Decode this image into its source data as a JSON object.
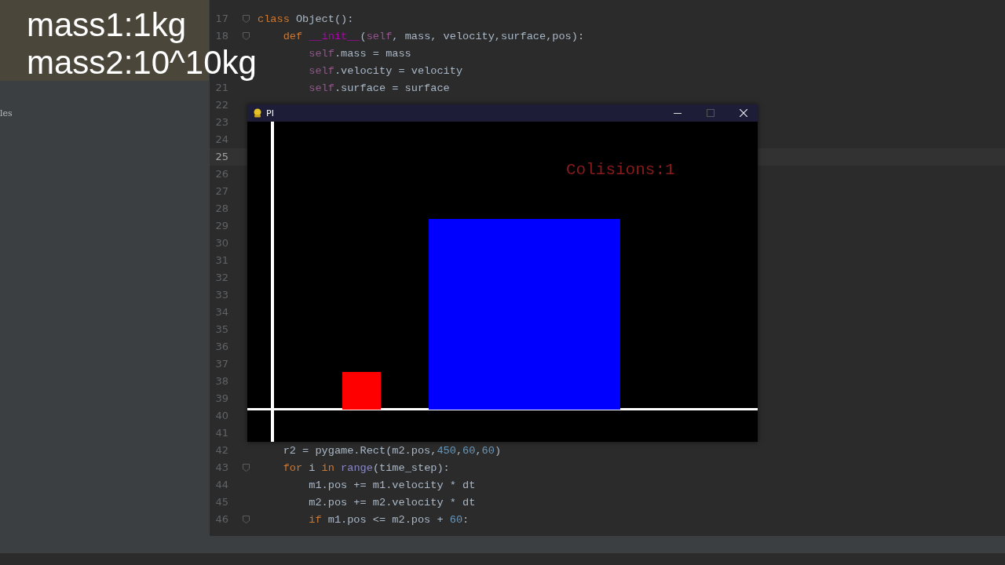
{
  "overlay_caption": [
    "mass1:1kg",
    "mass2:10^10kg"
  ],
  "sidebar": {
    "label": "les"
  },
  "editor": {
    "lines": [
      {
        "number": "17",
        "current": false,
        "fold": true,
        "kind": "flush",
        "tokens": [
          {
            "kind": "keyword",
            "text": "class"
          },
          {
            "kind": "plain",
            "text": " Object():"
          }
        ]
      },
      {
        "number": "18",
        "current": false,
        "fold": true,
        "kind": "indented",
        "tokens": [
          {
            "kind": "keyword",
            "text": "def "
          },
          {
            "kind": "magic",
            "text": "__init__"
          },
          {
            "kind": "plain",
            "text": "("
          },
          {
            "kind": "self",
            "text": "self"
          },
          {
            "kind": "plain",
            "text": ", mass, velocity,surface,pos):"
          }
        ]
      },
      {
        "current": false,
        "fold": false,
        "kind": "nested",
        "tokens": [
          {
            "kind": "self",
            "text": "self"
          },
          {
            "kind": "plain",
            "text": ".mass = mass"
          }
        ]
      },
      {
        "current": false,
        "fold": false,
        "kind": "nested",
        "tokens": [
          {
            "kind": "self",
            "text": "self"
          },
          {
            "kind": "plain",
            "text": ".velocity = velocity"
          }
        ]
      },
      {
        "number": "21",
        "current": false,
        "fold": false,
        "kind": "nested",
        "tokens": [
          {
            "kind": "self",
            "text": "self"
          },
          {
            "kind": "plain",
            "text": ".surface = surface"
          }
        ]
      },
      {
        "number": "22",
        "current": false,
        "fold": false
      },
      {
        "number": "23",
        "current": false,
        "fold": false
      },
      {
        "number": "24",
        "current": false,
        "fold": false
      },
      {
        "number": "25",
        "current": true,
        "fold": false
      },
      {
        "number": "26",
        "current": false,
        "fold": false
      },
      {
        "number": "27",
        "current": false,
        "fold": false
      },
      {
        "number": "28",
        "current": false,
        "fold": false
      },
      {
        "number": "29",
        "current": false,
        "fold": false
      },
      {
        "number": "30",
        "current": false,
        "fold": false
      },
      {
        "number": "31",
        "current": false,
        "fold": false
      },
      {
        "number": "32",
        "current": false,
        "fold": false
      },
      {
        "number": "33",
        "current": false,
        "fold": false
      },
      {
        "number": "34",
        "current": false,
        "fold": false
      },
      {
        "number": "35",
        "current": false,
        "fold": false
      },
      {
        "number": "36",
        "current": false,
        "fold": false
      },
      {
        "number": "37",
        "current": false,
        "fold": false
      },
      {
        "number": "38",
        "current": false,
        "fold": false
      },
      {
        "number": "39",
        "current": false,
        "fold": false
      },
      {
        "number": "40",
        "current": false,
        "fold": false
      },
      {
        "number": "41",
        "current": false,
        "fold": false
      },
      {
        "number": "42",
        "current": false,
        "fold": false,
        "kind": "indented",
        "tokens": [
          {
            "kind": "plain",
            "text": "r2 = pygame.Rect(m2.pos,"
          },
          {
            "kind": "number",
            "text": "450"
          },
          {
            "kind": "plain",
            "text": ","
          },
          {
            "kind": "number",
            "text": "60"
          },
          {
            "kind": "plain",
            "text": ","
          },
          {
            "kind": "number",
            "text": "60"
          },
          {
            "kind": "plain",
            "text": ")"
          }
        ]
      },
      {
        "number": "43",
        "current": false,
        "fold": true,
        "kind": "indented",
        "tokens": [
          {
            "kind": "keyword",
            "text": "for"
          },
          {
            "kind": "plain",
            "text": " i "
          },
          {
            "kind": "keyword",
            "text": "in "
          },
          {
            "kind": "builtin",
            "text": "range"
          },
          {
            "kind": "plain",
            "text": "(time_step):"
          }
        ]
      },
      {
        "number": "44",
        "current": false,
        "fold": false,
        "kind": "nested",
        "tokens": [
          {
            "kind": "plain",
            "text": "m1.pos += m1.velocity * dt"
          }
        ]
      },
      {
        "number": "45",
        "current": false,
        "fold": false,
        "kind": "nested",
        "tokens": [
          {
            "kind": "plain",
            "text": "m2.pos += m2.velocity * dt"
          }
        ]
      },
      {
        "number": "46",
        "current": false,
        "fold": true,
        "kind": "nested",
        "tokens": [
          {
            "kind": "keyword",
            "text": "if"
          },
          {
            "kind": "plain",
            "text": " m1.pos <= m2.pos + "
          },
          {
            "kind": "number",
            "text": "60"
          },
          {
            "kind": "plain",
            "text": ":"
          }
        ]
      }
    ]
  },
  "game_window": {
    "title": "PI",
    "counter": "Colisions:1",
    "blocks": [
      {
        "color": "#ff0000"
      },
      {
        "color": "#0000ff"
      }
    ]
  }
}
